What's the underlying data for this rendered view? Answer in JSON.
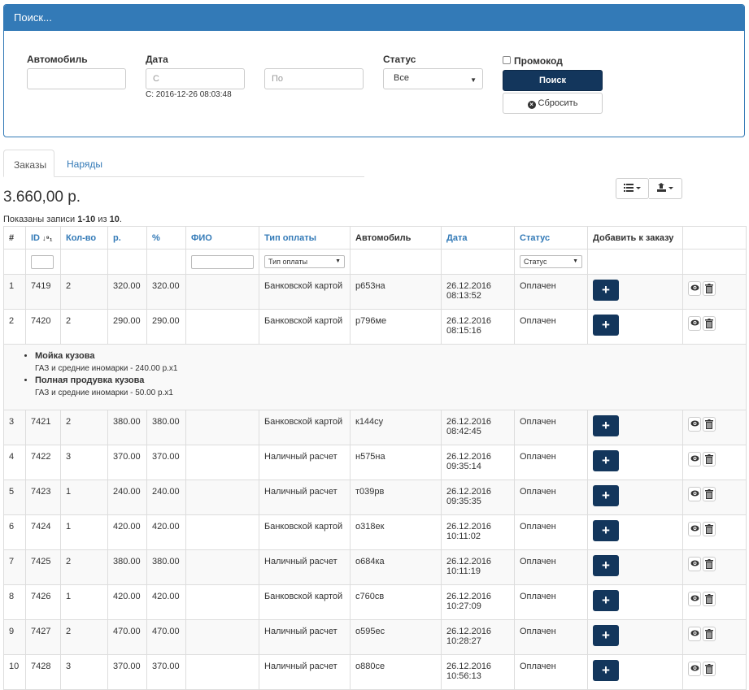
{
  "search": {
    "title": "Поиск...",
    "car_label": "Автомобиль",
    "car_value": "",
    "date_label": "Дата",
    "date_from_placeholder": "С",
    "date_to_placeholder": "По",
    "date_hint": "С: 2016-12-26 08:03:48",
    "status_label": "Статус",
    "status_value": "Все",
    "promo_label": "Промокод",
    "search_button": "Поиск",
    "reset_button": "Сбросить"
  },
  "tabs": [
    {
      "label": "Заказы",
      "active": true
    },
    {
      "label": "Наряды",
      "active": false
    }
  ],
  "total": "3.660,00 р.",
  "summary": {
    "prefix": "Показаны записи ",
    "range": "1-10",
    "middle": " из ",
    "count": "10",
    "suffix": "."
  },
  "table": {
    "headers": [
      "#",
      "ID",
      "Кол-во",
      "р.",
      "%",
      "ФИО",
      "Тип оплаты",
      "Автомобиль",
      "Дата",
      "Статус",
      "Добавить к заказу",
      ""
    ],
    "payment_filter_placeholder": "Тип оплаты",
    "status_filter_placeholder": "Статус",
    "rows": [
      {
        "n": "1",
        "id": "7419",
        "qty": "2",
        "rub": "320.00",
        "pct": "320.00",
        "fio": "",
        "pay": "Банковской картой",
        "car": "р653на",
        "date": "26.12.2016",
        "time": "08:13:52",
        "status": "Оплачен"
      },
      {
        "n": "2",
        "id": "7420",
        "qty": "2",
        "rub": "290.00",
        "pct": "290.00",
        "fio": "",
        "pay": "Банковской картой",
        "car": "р796ме",
        "date": "26.12.2016",
        "time": "08:15:16",
        "status": "Оплачен"
      },
      {
        "n": "3",
        "id": "7421",
        "qty": "2",
        "rub": "380.00",
        "pct": "380.00",
        "fio": "",
        "pay": "Банковской картой",
        "car": "к144су",
        "date": "26.12.2016",
        "time": "08:42:45",
        "status": "Оплачен"
      },
      {
        "n": "4",
        "id": "7422",
        "qty": "3",
        "rub": "370.00",
        "pct": "370.00",
        "fio": "",
        "pay": "Наличный расчет",
        "car": "н575на",
        "date": "26.12.2016",
        "time": "09:35:14",
        "status": "Оплачен"
      },
      {
        "n": "5",
        "id": "7423",
        "qty": "1",
        "rub": "240.00",
        "pct": "240.00",
        "fio": "",
        "pay": "Наличный расчет",
        "car": "т039рв",
        "date": "26.12.2016",
        "time": "09:35:35",
        "status": "Оплачен"
      },
      {
        "n": "6",
        "id": "7424",
        "qty": "1",
        "rub": "420.00",
        "pct": "420.00",
        "fio": "",
        "pay": "Банковской картой",
        "car": "о318ек",
        "date": "26.12.2016",
        "time": "10:11:02",
        "status": "Оплачен"
      },
      {
        "n": "7",
        "id": "7425",
        "qty": "2",
        "rub": "380.00",
        "pct": "380.00",
        "fio": "",
        "pay": "Наличный расчет",
        "car": "о684ка",
        "date": "26.12.2016",
        "time": "10:11:19",
        "status": "Оплачен"
      },
      {
        "n": "8",
        "id": "7426",
        "qty": "1",
        "rub": "420.00",
        "pct": "420.00",
        "fio": "",
        "pay": "Банковской картой",
        "car": "с760св",
        "date": "26.12.2016",
        "time": "10:27:09",
        "status": "Оплачен"
      },
      {
        "n": "9",
        "id": "7427",
        "qty": "2",
        "rub": "470.00",
        "pct": "470.00",
        "fio": "",
        "pay": "Наличный расчет",
        "car": "о595ес",
        "date": "26.12.2016",
        "time": "10:28:27",
        "status": "Оплачен"
      },
      {
        "n": "10",
        "id": "7428",
        "qty": "3",
        "rub": "370.00",
        "pct": "370.00",
        "fio": "",
        "pay": "Наличный расчет",
        "car": "о880се",
        "date": "26.12.2016",
        "time": "10:56:13",
        "status": "Оплачен"
      }
    ],
    "detail_after_row": 2,
    "detail_items": [
      {
        "title": "Мойка кузова",
        "sub_prefix": "ГАЗ и средние иномарки - ",
        "sub_price": "240.00 р.x1"
      },
      {
        "title": "Полная продувка кузова",
        "sub_prefix": "ГАЗ и средние иномарки - ",
        "sub_price": "50.00 р.x1"
      }
    ]
  },
  "icons": {
    "sort": "sort-numeric-desc-icon",
    "add": "plus-icon",
    "view": "eye-icon",
    "delete": "trash-icon",
    "columns": "list-icon",
    "export": "export-icon",
    "reset": "remove-circle-icon"
  },
  "colors": {
    "primary": "#337ab7",
    "dark_button": "#13365c"
  }
}
